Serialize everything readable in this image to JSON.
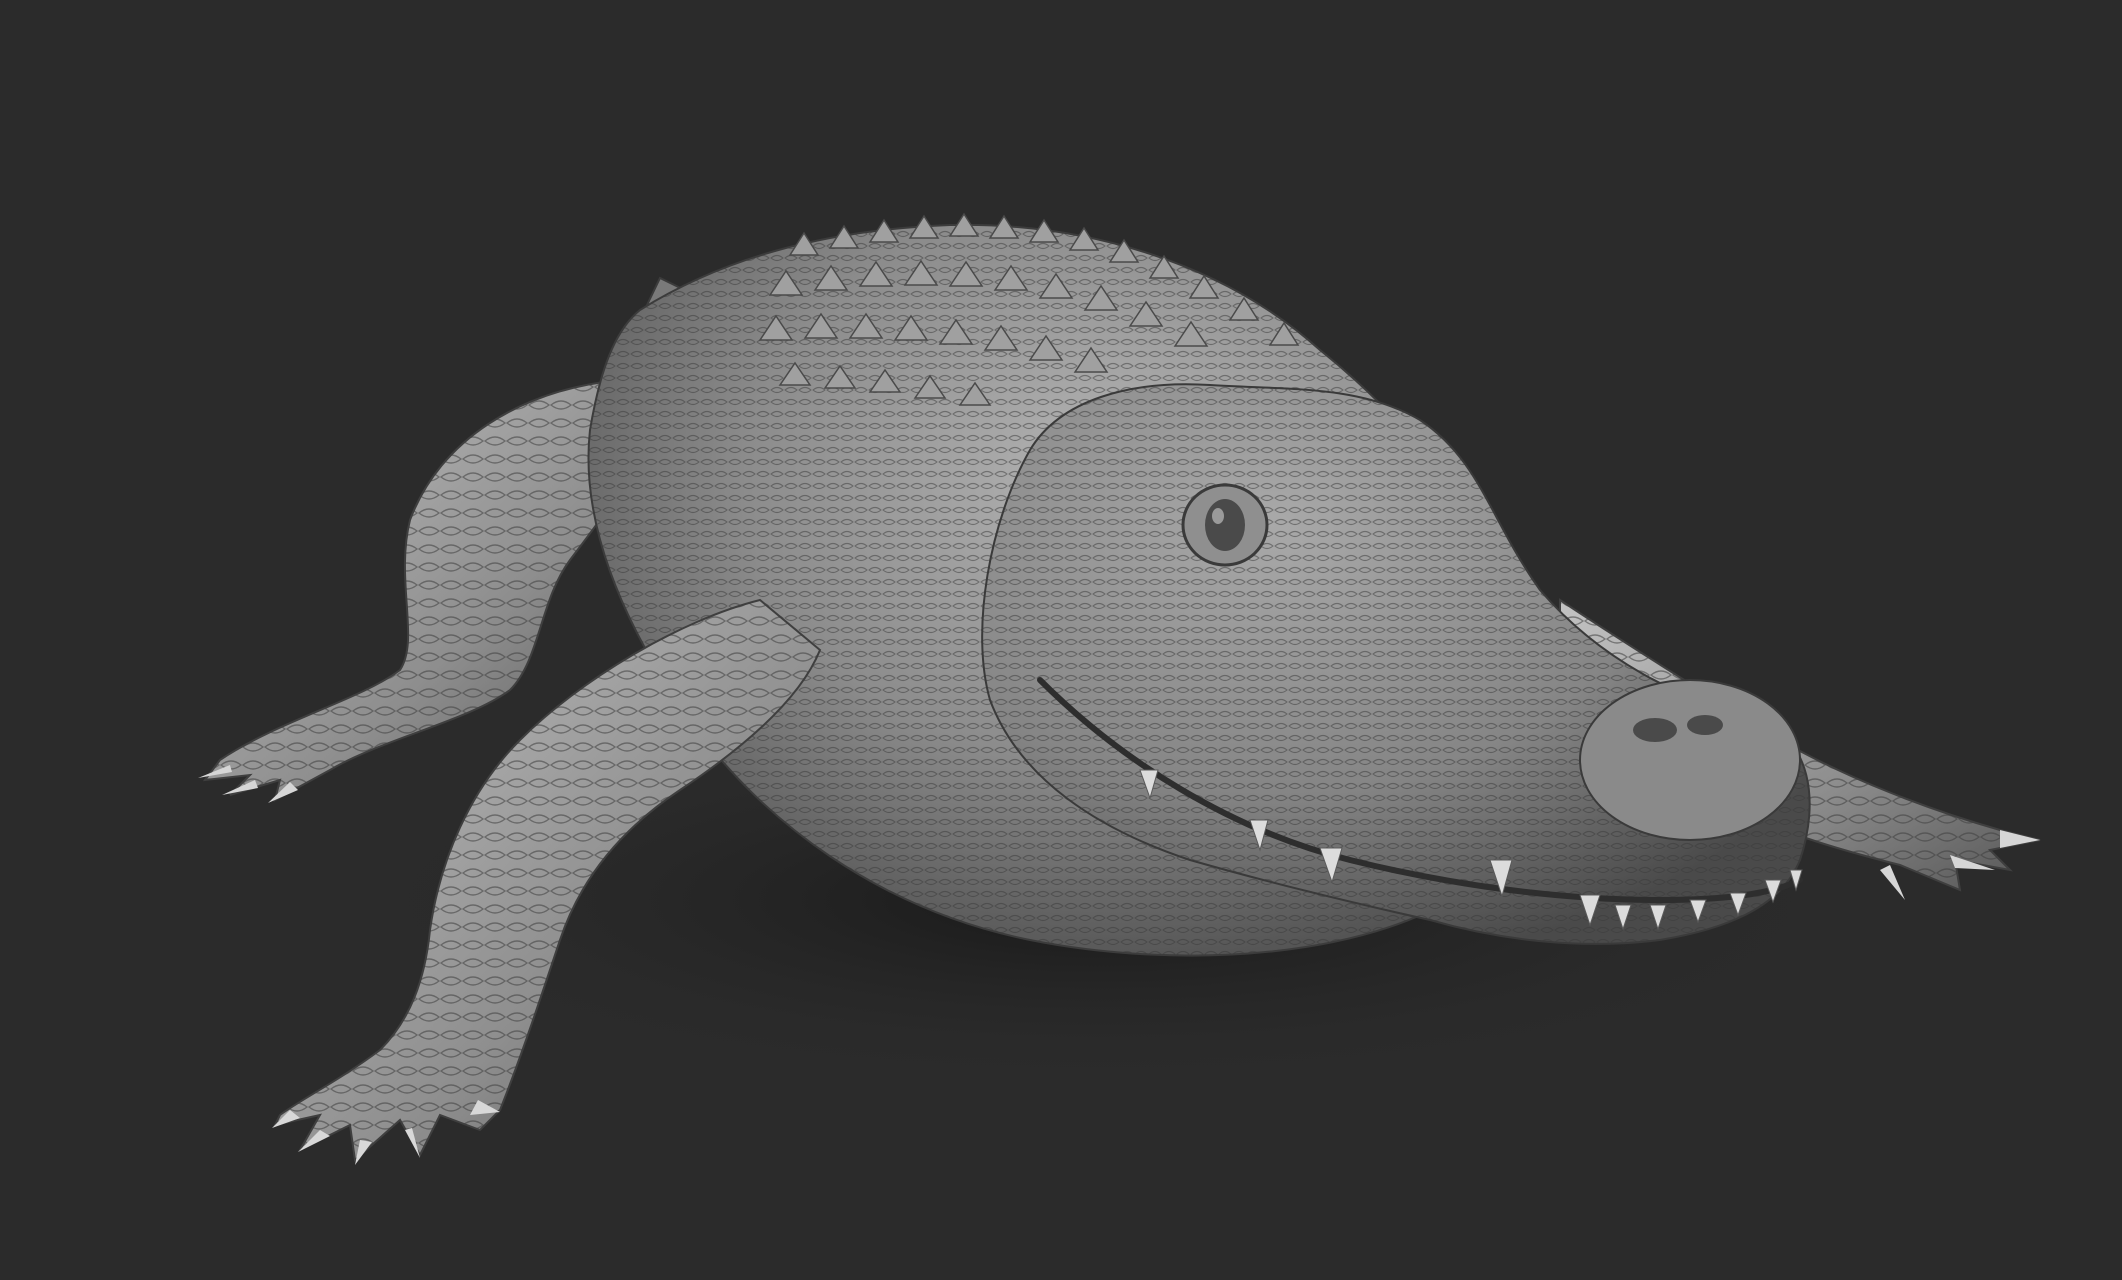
{
  "scene": {
    "subject": "alligator-sculpt",
    "colors": {
      "background": "#2b2b2b",
      "skin_light": "#b9b9b9",
      "skin_mid": "#8f8f8f",
      "skin_dark": "#5a5a5a",
      "shadow": "#1c1c1c",
      "claw": "#d8d8d8",
      "eye": "#3a3a3a"
    }
  }
}
